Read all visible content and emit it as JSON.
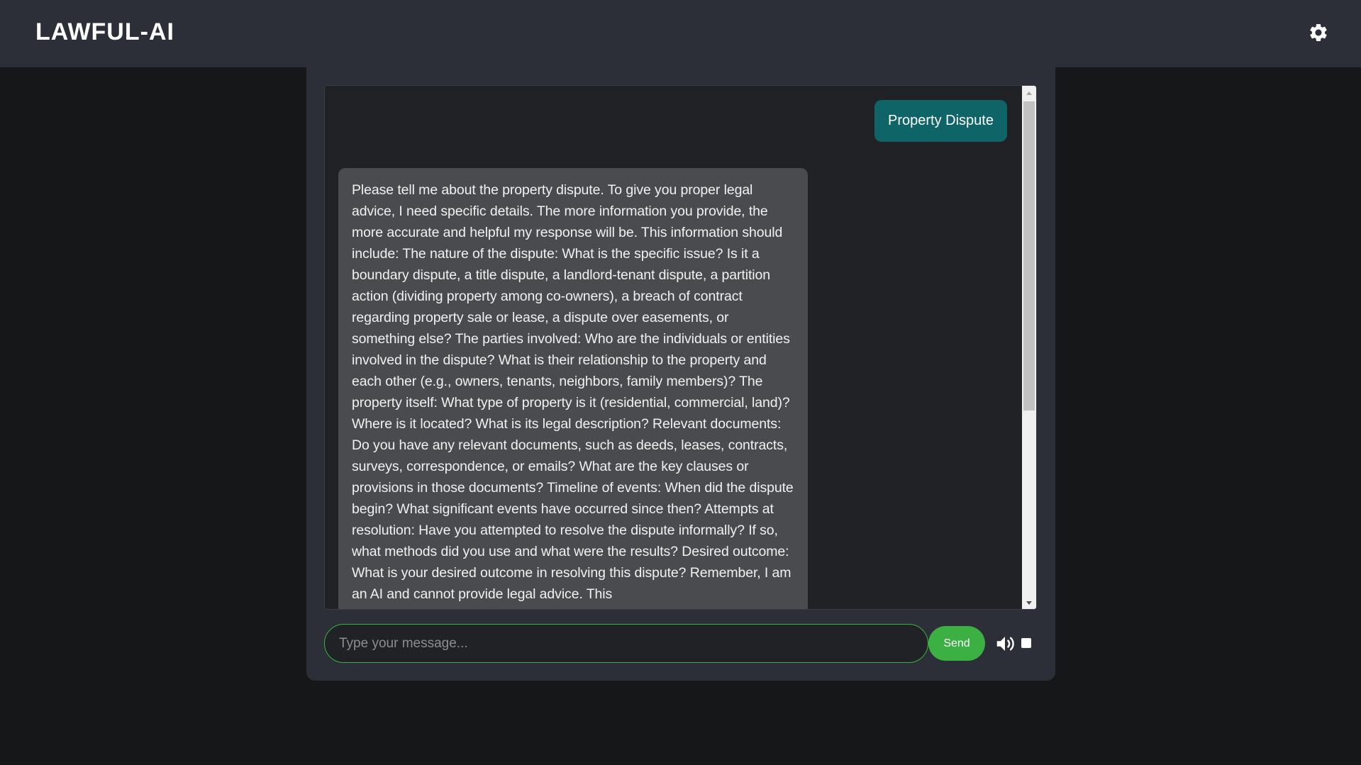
{
  "header": {
    "title": "LAWFUL-AI",
    "settings_icon": "gear-icon"
  },
  "chat": {
    "messages": [
      {
        "role": "user",
        "text": "Property Dispute"
      },
      {
        "role": "assistant",
        "text": "Please tell me about the property dispute. To give you proper legal advice, I need specific details. The more information you provide, the more accurate and helpful my response will be. This information should include: The nature of the dispute: What is the specific issue? Is it a boundary dispute, a title dispute, a landlord-tenant dispute, a partition action (dividing property among co-owners), a breach of contract regarding property sale or lease, a dispute over easements, or something else? The parties involved: Who are the individuals or entities involved in the dispute? What is their relationship to the property and each other (e.g., owners, tenants, neighbors, family members)? The property itself: What type of property is it (residential, commercial, land)? Where is it located? What is its legal description? Relevant documents: Do you have any relevant documents, such as deeds, leases, contracts, surveys, correspondence, or emails? What are the key clauses or provisions in those documents? Timeline of events: When did the dispute begin? What significant events have occurred since then? Attempts at resolution: Have you attempted to resolve the dispute informally? If so, what methods did you use and what were the results? Desired outcome: What is your desired outcome in resolving this dispute? Remember, I am an AI and cannot provide legal advice. This"
      }
    ]
  },
  "composer": {
    "placeholder": "Type your message...",
    "value": "",
    "send_label": "Send",
    "speaker_icon": "speaker-icon",
    "stop_icon": "stop-square-icon"
  },
  "colors": {
    "topbar": "#2c2f37",
    "page_background": "#161719",
    "user_bubble": "#0e6467",
    "assistant_bubble": "#4a4b4e",
    "accent_green": "#3cb043"
  }
}
